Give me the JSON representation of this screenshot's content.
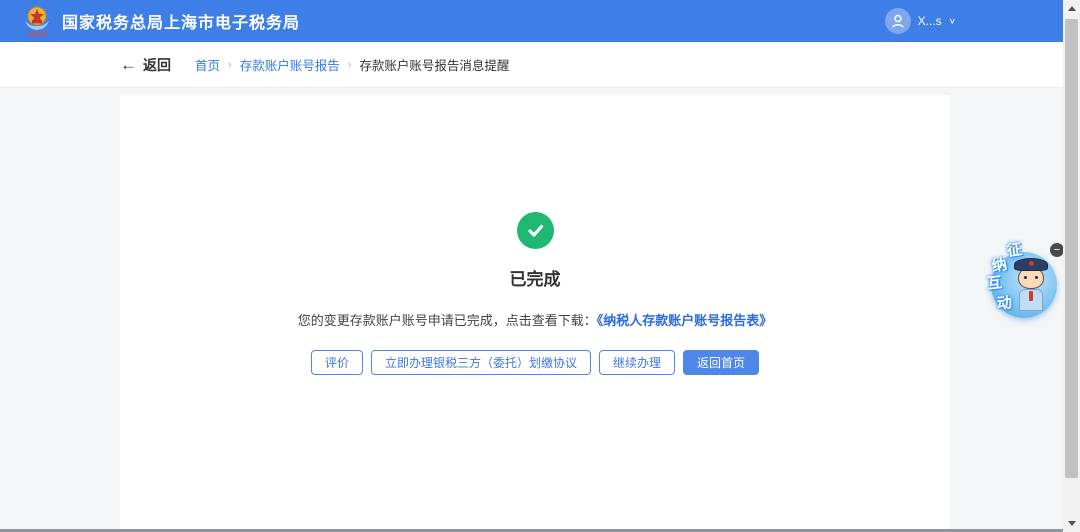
{
  "header": {
    "title": "国家税务总局上海市电子税务局",
    "logo_name": "china-tax-emblem",
    "user": {
      "name": "X...s",
      "chevron": "∨"
    }
  },
  "nav": {
    "back_arrow": "←",
    "back_label": "返回",
    "separator": "›",
    "breadcrumbs": [
      {
        "label": "首页"
      },
      {
        "label": "存款账户账号报告"
      },
      {
        "label": "存款账户账号报告消息提醒"
      }
    ]
  },
  "result": {
    "status_title": "已完成",
    "message_prefix": "您的变更存款账户账号申请已完成，点击查看下载：",
    "download_link": "《纳税人存款账户账号报告表》",
    "buttons": [
      {
        "label": "评价",
        "variant": "outline"
      },
      {
        "label": "立即办理银税三方（委托）划缴协议",
        "variant": "outline"
      },
      {
        "label": "继续办理",
        "variant": "outline"
      },
      {
        "label": "返回首页",
        "variant": "primary"
      }
    ]
  },
  "assistant_widget": {
    "chars": [
      "征",
      "纳",
      "互",
      "动"
    ],
    "collapse_icon": "−"
  },
  "colors": {
    "header_blue": "#3d7ee7",
    "success_green": "#1fb873",
    "link_blue": "#2b6be3",
    "button_blue": "#4e87e8",
    "background_gray": "#f4f5f7"
  }
}
